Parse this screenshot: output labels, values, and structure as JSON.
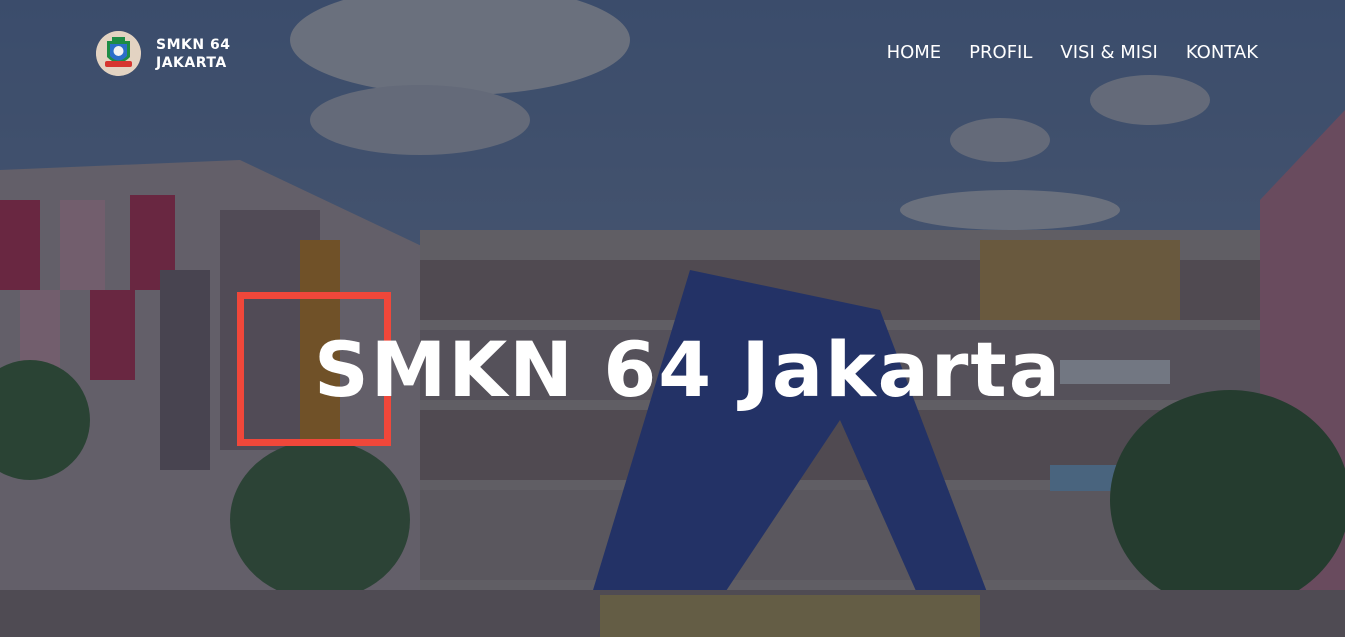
{
  "brand": {
    "line1": "SMKN 64",
    "line2": "JAKARTA",
    "logo_icon": "school-emblem-icon"
  },
  "nav": {
    "items": [
      "HOME",
      "PROFIL",
      "VISI & MISI",
      "KONTAK"
    ]
  },
  "hero": {
    "title": "SMKN 64 Jakarta",
    "accent_color": "#f0473a",
    "background_image": "school building photograph"
  }
}
